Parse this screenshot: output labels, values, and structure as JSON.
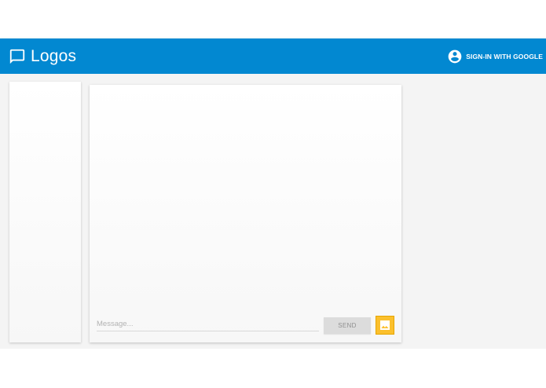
{
  "app": {
    "title": "Logos",
    "brand_icon": "chat-bubble-icon",
    "accent_color": "#0288d1"
  },
  "header": {
    "signin_label": "SIGN-IN WITH GOOGLE",
    "signin_icon": "account-circle-icon"
  },
  "composer": {
    "message_placeholder": "Message...",
    "message_value": "",
    "send_label": "SEND",
    "image_icon": "image-icon",
    "image_button_color": "#fbc02d"
  }
}
